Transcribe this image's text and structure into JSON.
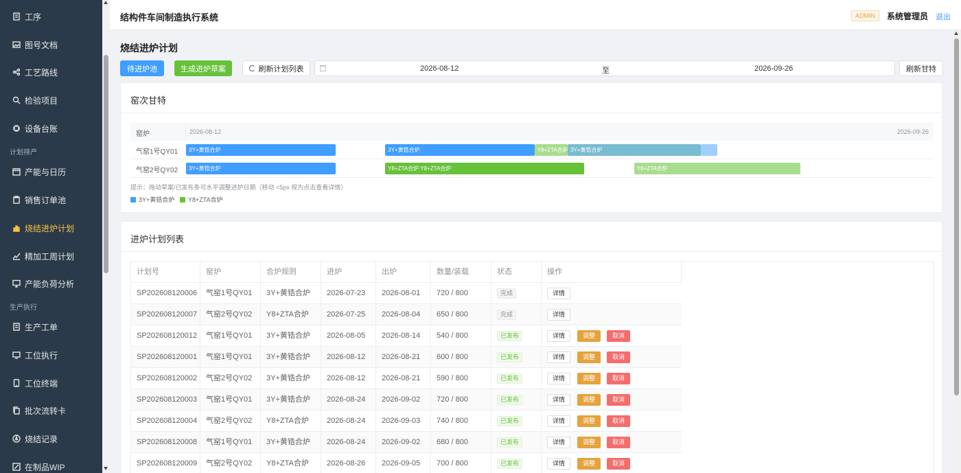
{
  "sidebar": {
    "groups": {
      "plan": "计划排产",
      "exec": "生产执行"
    },
    "items": [
      {
        "label": "工序",
        "icon": "document-icon"
      },
      {
        "label": "图号文档",
        "icon": "picture-icon"
      },
      {
        "label": "工艺路线",
        "icon": "share-icon"
      },
      {
        "label": "检验项目",
        "icon": "search-icon"
      },
      {
        "label": "设备台账",
        "icon": "chip-icon"
      },
      {
        "label": "产能与日历",
        "icon": "calendar-icon"
      },
      {
        "label": "销售订单池",
        "icon": "clipboard-icon"
      },
      {
        "label": "烧结进炉计划",
        "icon": "bar-chart-icon",
        "active": true
      },
      {
        "label": "精加工周计划",
        "icon": "trend-icon"
      },
      {
        "label": "产能负荷分析",
        "icon": "presentation-icon"
      },
      {
        "label": "生产工单",
        "icon": "document-icon"
      },
      {
        "label": "工位执行",
        "icon": "monitor-icon"
      },
      {
        "label": "工位终端",
        "icon": "tablet-icon"
      },
      {
        "label": "批次流转卡",
        "icon": "copy-icon"
      },
      {
        "label": "烧结记录",
        "icon": "compass-icon"
      },
      {
        "label": "在制品WIP",
        "icon": "edit-icon"
      }
    ]
  },
  "header": {
    "title": "结构件车间制造执行系统",
    "role": "ADMIN",
    "user": "系统管理员",
    "logout": "退出"
  },
  "page": {
    "title": "烧结进炉计划",
    "toolbar": {
      "pool": "待进炉池",
      "draft": "生成进炉草案",
      "refresh_list": "刷新计划列表",
      "date_start": "2026-08-12",
      "date_sep": "至",
      "date_end": "2026-09-26",
      "refresh_gantt": "刷新甘特"
    }
  },
  "gantt": {
    "title": "窑次甘特",
    "col_label": "窑炉",
    "range_start": "2026-08-12",
    "range_end": "2026-09-26",
    "hint": "提示：拖动草案/已发布条可水平调整进炉日期（移动 <5px 视为点击查看详情）",
    "colors": {
      "blue": "#409eff",
      "green": "#67c23a",
      "blue_light": "#a0cfff",
      "green_light": "#a9dd8e",
      "teal": "#79bbd0"
    },
    "legend": [
      {
        "label": "3Y+黄锆合炉",
        "color": "#409eff"
      },
      {
        "label": "Y8+ZTA合炉",
        "color": "#67c23a"
      }
    ],
    "rows": [
      {
        "label": "气窑1号QY01",
        "bars": [
          {
            "label": "3Y+黄锆合炉",
            "start": "2026-08-12",
            "end": "2026-08-21",
            "color": "#409eff"
          },
          {
            "label": "3Y+黄锆合炉",
            "start": "2026-08-24",
            "end": "2026-09-02",
            "color": "#409eff"
          },
          {
            "label": "Y8+ZTA合炉",
            "start": "2026-09-02",
            "end": "2026-09-04",
            "color": "#a9dd8e"
          },
          {
            "label": "3Y+黄锆合炉",
            "start": "2026-09-04",
            "end": "2026-09-12",
            "color": "#79bbd0"
          },
          {
            "label": "",
            "start": "2026-09-12",
            "end": "2026-09-13",
            "color": "#a0cfff"
          }
        ]
      },
      {
        "label": "气窑2号QY02",
        "bars": [
          {
            "label": "3Y+黄锆合炉",
            "start": "2026-08-12",
            "end": "2026-08-21",
            "color": "#409eff"
          },
          {
            "label": "Y8+ZTA合炉  Y8+ZTA合炉",
            "start": "2026-08-24",
            "end": "2026-09-05",
            "color": "#67c23a"
          },
          {
            "label": "Y8+ZTA合炉",
            "start": "2026-09-08",
            "end": "2026-09-18",
            "color": "#a9dd8e"
          }
        ]
      }
    ]
  },
  "plans": {
    "title": "进炉计划列表",
    "columns": [
      "计划号",
      "窑炉",
      "合炉规则",
      "进炉",
      "出炉",
      "数量/装载",
      "状态",
      "操作"
    ],
    "actions": {
      "detail": "详情",
      "adjust": "调整",
      "cancel": "取消"
    },
    "rows": [
      {
        "id": "SP202608120006",
        "kiln": "气窑1号QY01",
        "rule": "3Y+黄锆合炉",
        "in": "2026-07-23",
        "out": "2026-08-01",
        "qty": "720 / 800",
        "status": "完成",
        "type": "done"
      },
      {
        "id": "SP202608120007",
        "kiln": "气窑2号QY02",
        "rule": "Y8+ZTA合炉",
        "in": "2026-07-25",
        "out": "2026-08-04",
        "qty": "650 / 800",
        "status": "完成",
        "type": "done"
      },
      {
        "id": "SP202608120012",
        "kiln": "气窑1号QY01",
        "rule": "3Y+黄锆合炉",
        "in": "2026-08-05",
        "out": "2026-08-14",
        "qty": "540 / 800",
        "status": "已发布",
        "type": "pub"
      },
      {
        "id": "SP202608120001",
        "kiln": "气窑1号QY01",
        "rule": "3Y+黄锆合炉",
        "in": "2026-08-12",
        "out": "2026-08-21",
        "qty": "600 / 800",
        "status": "已发布",
        "type": "pub"
      },
      {
        "id": "SP202608120002",
        "kiln": "气窑2号QY02",
        "rule": "3Y+黄锆合炉",
        "in": "2026-08-12",
        "out": "2026-08-21",
        "qty": "590 / 800",
        "status": "已发布",
        "type": "pub"
      },
      {
        "id": "SP202608120003",
        "kiln": "气窑1号QY01",
        "rule": "3Y+黄锆合炉",
        "in": "2026-08-24",
        "out": "2026-09-02",
        "qty": "720 / 800",
        "status": "已发布",
        "type": "pub"
      },
      {
        "id": "SP202608120004",
        "kiln": "气窑2号QY02",
        "rule": "Y8+ZTA合炉",
        "in": "2026-08-24",
        "out": "2026-09-03",
        "qty": "740 / 800",
        "status": "已发布",
        "type": "pub"
      },
      {
        "id": "SP202608120008",
        "kiln": "气窑1号QY01",
        "rule": "3Y+黄锆合炉",
        "in": "2026-08-24",
        "out": "2026-09-02",
        "qty": "680 / 800",
        "status": "已发布",
        "type": "pub"
      },
      {
        "id": "SP202608120009",
        "kiln": "气窑2号QY02",
        "rule": "Y8+ZTA合炉",
        "in": "2026-08-26",
        "out": "2026-09-05",
        "qty": "700 / 800",
        "status": "已发布",
        "type": "pub"
      }
    ]
  }
}
